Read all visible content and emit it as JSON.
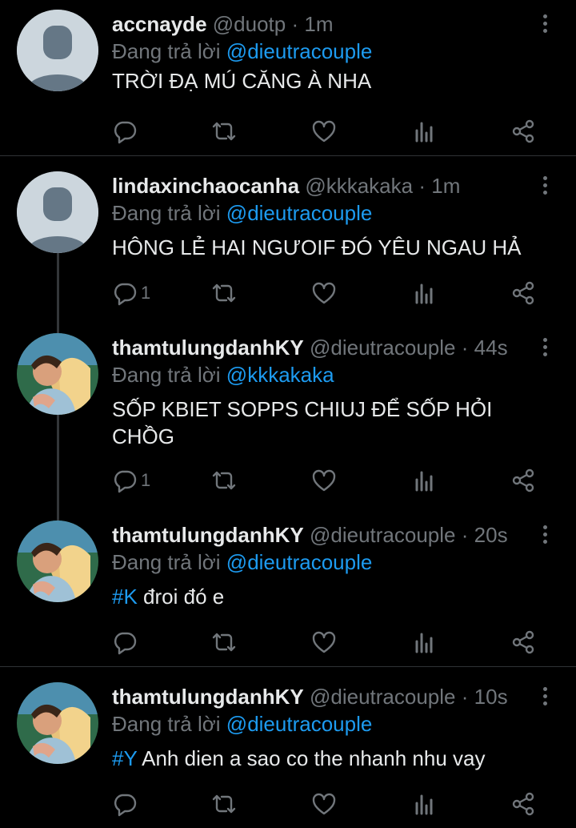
{
  "reply_prefix": "Đang trả lời",
  "tweets": [
    {
      "name": "accnayde",
      "handle": "@duotp",
      "time": "1m",
      "reply_to": "@dieutracouple",
      "text_lines": [
        "TRỜI ĐẠ MÚ CĂNG À NHA"
      ],
      "hashtag": "",
      "reply_count": ""
    },
    {
      "name": "lindaxinchaocanha",
      "handle": "@kkkakaka",
      "time": "1m",
      "reply_to": "@dieutracouple",
      "text_lines": [
        "HÔNG LẺ HAI NGƯOIF ĐÓ YÊU NGAU HẢ"
      ],
      "hashtag": "",
      "reply_count": "1"
    },
    {
      "name": "thamtulungdanhKY",
      "handle": "@dieutracouple",
      "time": "44s",
      "reply_to": "@kkkakaka",
      "text_lines": [
        "SỐP KBIET SOPPS CHIUJ ĐỂ SỐP HỎI",
        "CHỒG"
      ],
      "hashtag": "",
      "reply_count": "1"
    },
    {
      "name": "thamtulungdanhKY",
      "handle": "@dieutracouple",
      "time": "20s",
      "reply_to": "@dieutracouple",
      "hashtag": "#K",
      "text_rest": " đroi đó e",
      "reply_count": ""
    },
    {
      "name": "thamtulungdanhKY",
      "handle": "@dieutracouple",
      "time": "10s",
      "reply_to": "@dieutracouple",
      "hashtag": "#Y",
      "text_rest": " Anh dien a sao co the nhanh nhu vay",
      "reply_count": ""
    }
  ],
  "colors": {
    "background": "#000000",
    "text": "#e7e9ea",
    "secondary": "#71767b",
    "accent": "#1d9bf0",
    "divider": "#2f3336"
  },
  "icons": [
    "reply-icon",
    "retweet-icon",
    "like-icon",
    "analytics-icon",
    "share-icon",
    "more-icon"
  ]
}
